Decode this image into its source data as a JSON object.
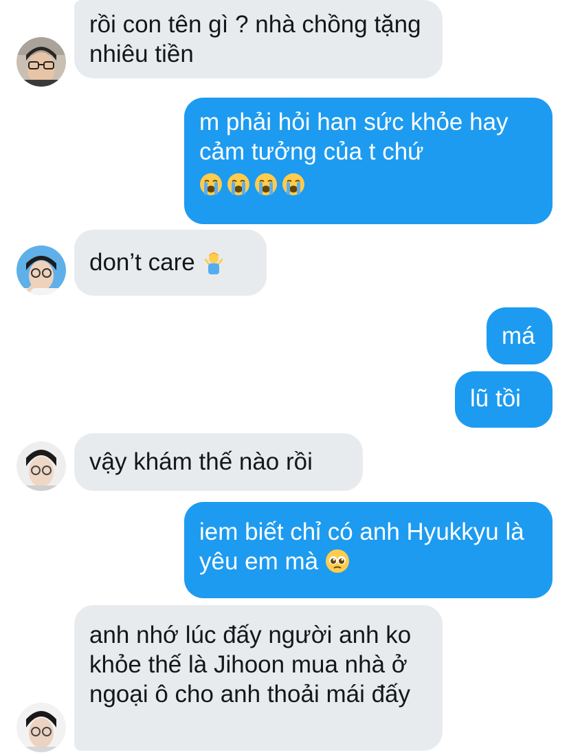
{
  "messages": [
    {
      "from": "them",
      "text": "rồi con tên gì ? nhà chồng tặng nhiêu tiền"
    },
    {
      "from": "me",
      "text": "m phải hỏi han sức khỏe hay cảm tưởng của t chứ",
      "emoji": "crying-face x4"
    },
    {
      "from": "them",
      "text": "don’t care",
      "emoji": "person-shrugging"
    },
    {
      "from": "me",
      "text": "má"
    },
    {
      "from": "me",
      "text": "lũ tồi"
    },
    {
      "from": "them",
      "text": "vậy khám thế nào rồi"
    },
    {
      "from": "me",
      "text": "iem biết chỉ có anh Hyukkyu là yêu em mà",
      "emoji": "pleading-face"
    },
    {
      "from": "them",
      "text": "anh nhớ lúc đấy người anh ko khỏe thế là Jihoon mua nhà ở ngoại ô cho anh thoải mái đấy"
    }
  ],
  "colors": {
    "incoming_bubble": "#e8ebee",
    "outgoing_bubble": "#1d9bf0",
    "incoming_text": "#14171a",
    "outgoing_text": "#ffffff"
  }
}
